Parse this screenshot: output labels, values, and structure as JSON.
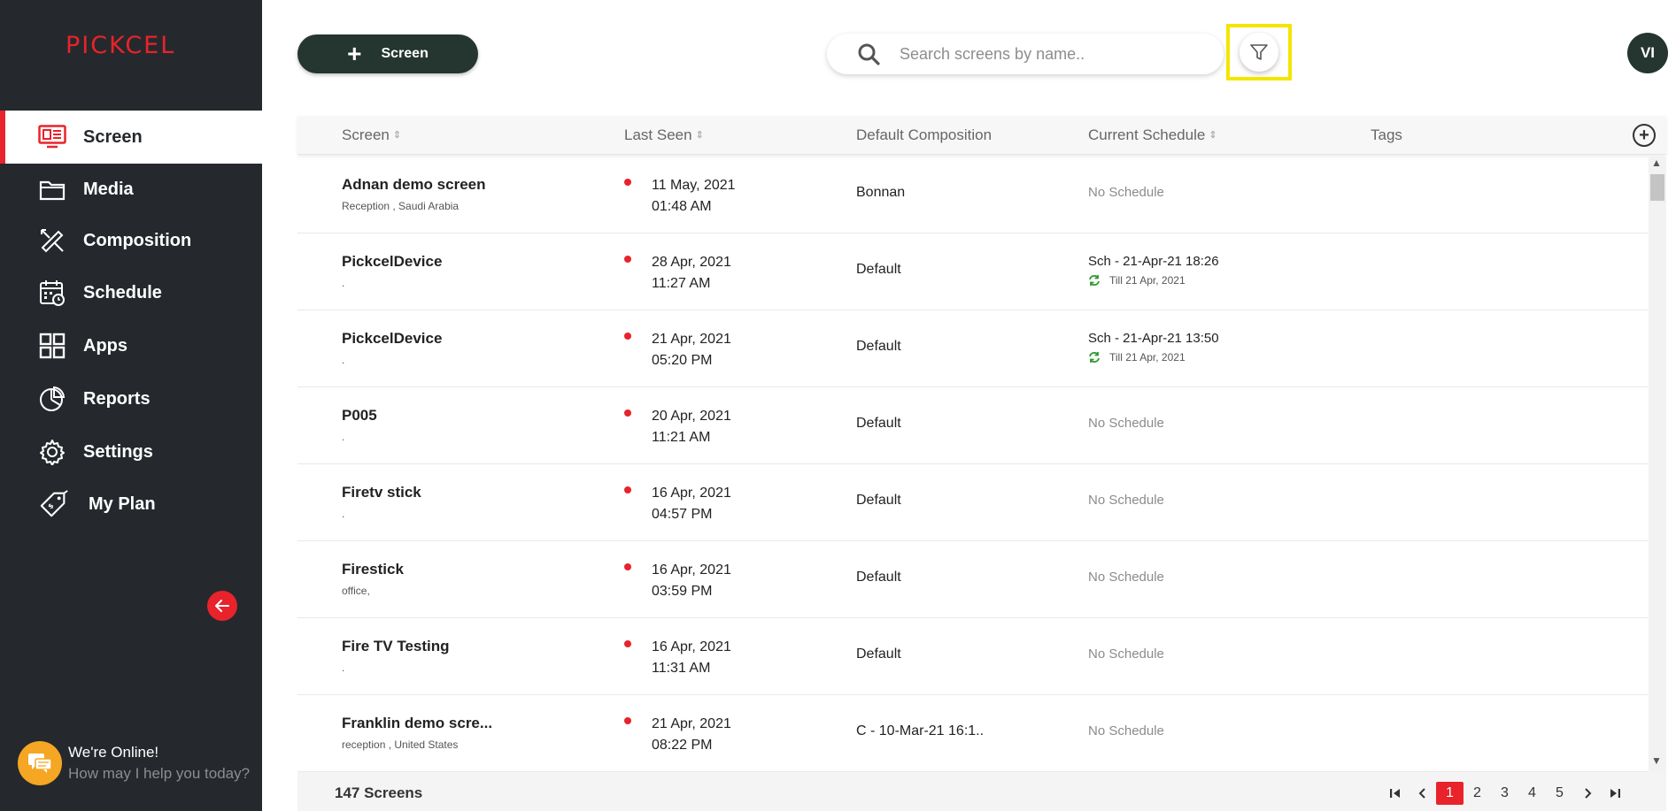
{
  "app": {
    "logo_text": "PICKCEL",
    "brand_color": "#e8232b"
  },
  "sidebar": {
    "items": [
      {
        "label": "Screen",
        "icon": "screen-icon",
        "active": true
      },
      {
        "label": "Media",
        "icon": "folder-icon",
        "active": false
      },
      {
        "label": "Composition",
        "icon": "composition-icon",
        "active": false
      },
      {
        "label": "Schedule",
        "icon": "calendar-icon",
        "active": false
      },
      {
        "label": "Apps",
        "icon": "apps-grid-icon",
        "active": false
      },
      {
        "label": "Reports",
        "icon": "pie-chart-icon",
        "active": false
      },
      {
        "label": "Settings",
        "icon": "gear-icon",
        "active": false
      },
      {
        "label": "My Plan",
        "icon": "price-tag-icon",
        "active": false
      }
    ]
  },
  "chat": {
    "title": "We're Online!",
    "subtitle": "How may I help you today?"
  },
  "toolbar": {
    "add_label": "Screen",
    "search_placeholder": "Search screens by name..",
    "avatar_initials": "VI"
  },
  "table": {
    "columns": [
      "Screen",
      "Last Seen",
      "Default Composition",
      "Current Schedule",
      "Tags"
    ],
    "rows": [
      {
        "name": "Adnan demo screen",
        "location": "Reception , Saudi Arabia",
        "seen_date": "11 May, 2021",
        "seen_time": "01:48 AM",
        "composition": "Bonnan",
        "schedule": "No Schedule",
        "schedule_sub": ""
      },
      {
        "name": "PickcelDevice",
        "location": ".",
        "seen_date": "28 Apr, 2021",
        "seen_time": "11:27 AM",
        "composition": "Default",
        "schedule": "Sch - 21-Apr-21 18:26",
        "schedule_sub": "Till 21 Apr, 2021"
      },
      {
        "name": "PickcelDevice",
        "location": ".",
        "seen_date": "21 Apr, 2021",
        "seen_time": "05:20 PM",
        "composition": "Default",
        "schedule": "Sch - 21-Apr-21 13:50",
        "schedule_sub": "Till 21 Apr, 2021"
      },
      {
        "name": "P005",
        "location": ".",
        "seen_date": "20 Apr, 2021",
        "seen_time": "11:21 AM",
        "composition": "Default",
        "schedule": "No Schedule",
        "schedule_sub": ""
      },
      {
        "name": "Firetv stick",
        "location": ".",
        "seen_date": "16 Apr, 2021",
        "seen_time": "04:57 PM",
        "composition": "Default",
        "schedule": "No Schedule",
        "schedule_sub": ""
      },
      {
        "name": "Firestick",
        "location": "office,",
        "seen_date": "16 Apr, 2021",
        "seen_time": "03:59 PM",
        "composition": "Default",
        "schedule": "No Schedule",
        "schedule_sub": ""
      },
      {
        "name": "Fire TV Testing",
        "location": ".",
        "seen_date": "16 Apr, 2021",
        "seen_time": "11:31 AM",
        "composition": "Default",
        "schedule": "No Schedule",
        "schedule_sub": ""
      },
      {
        "name": "Franklin demo scre...",
        "location": "reception , United States",
        "seen_date": "21 Apr, 2021",
        "seen_time": "08:22 PM",
        "composition": "C - 10-Mar-21 16:1..",
        "schedule": "No Schedule",
        "schedule_sub": ""
      }
    ]
  },
  "footer": {
    "count_label": "147 Screens",
    "pages": [
      "1",
      "2",
      "3",
      "4",
      "5"
    ],
    "current_page": "1"
  }
}
